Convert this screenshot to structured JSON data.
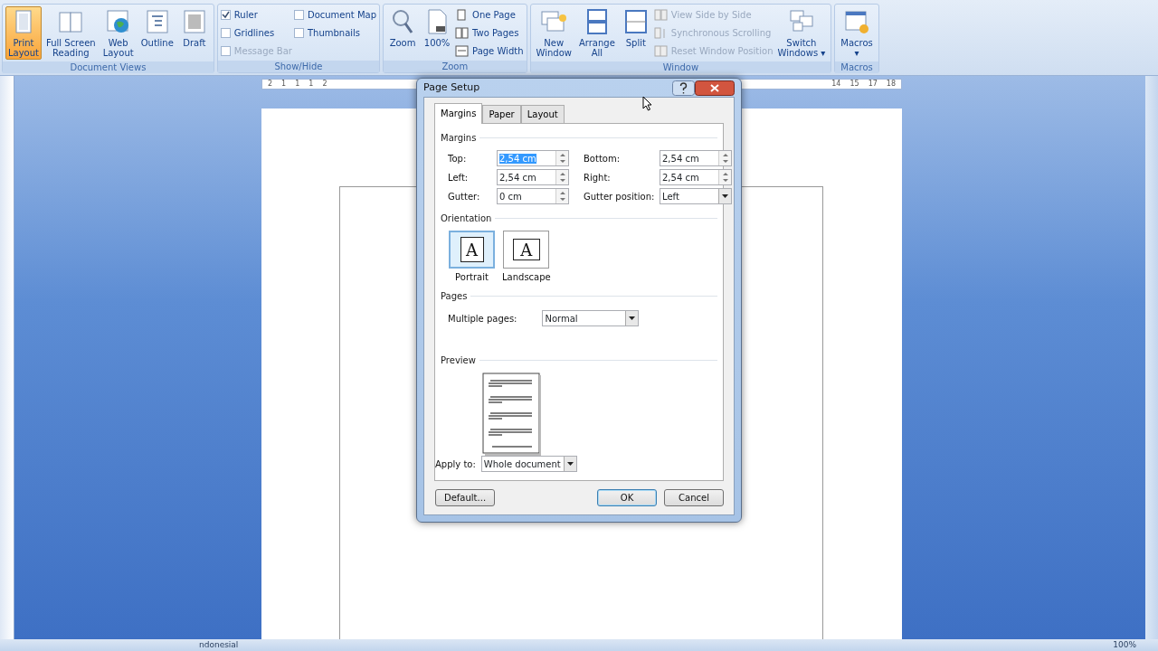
{
  "ribbon": {
    "groups": [
      {
        "label": "Document Views",
        "items": [
          {
            "kind": "big",
            "label": "Print\nLayout",
            "selected": true,
            "disabled": false
          },
          {
            "kind": "big",
            "label": "Full Screen\nReading",
            "selected": false,
            "disabled": false
          },
          {
            "kind": "big",
            "label": "Web\nLayout",
            "selected": false,
            "disabled": false
          },
          {
            "kind": "big",
            "label": "Outline",
            "selected": false,
            "disabled": false
          },
          {
            "kind": "big",
            "label": "Draft",
            "selected": false,
            "disabled": false
          }
        ]
      },
      {
        "label": "Show/Hide",
        "items": [
          {
            "kind": "check",
            "label": "Ruler",
            "checked": true,
            "disabled": false
          },
          {
            "kind": "check",
            "label": "Gridlines",
            "checked": false,
            "disabled": false
          },
          {
            "kind": "check",
            "label": "Message Bar",
            "checked": false,
            "disabled": true
          },
          {
            "kind": "check",
            "label": "Document Map",
            "checked": false,
            "disabled": false
          },
          {
            "kind": "check",
            "label": "Thumbnails",
            "checked": false,
            "disabled": false
          }
        ]
      },
      {
        "label": "Zoom",
        "items": [
          {
            "kind": "big",
            "label": "Zoom",
            "selected": false,
            "disabled": false
          },
          {
            "kind": "big",
            "label": "100%",
            "selected": false,
            "disabled": false
          },
          {
            "kind": "small",
            "label": "One Page",
            "disabled": false
          },
          {
            "kind": "small",
            "label": "Two Pages",
            "disabled": false
          },
          {
            "kind": "small",
            "label": "Page Width",
            "disabled": false
          }
        ]
      },
      {
        "label": "Window",
        "items": [
          {
            "kind": "big",
            "label": "New\nWindow",
            "selected": false,
            "disabled": false
          },
          {
            "kind": "big",
            "label": "Arrange\nAll",
            "selected": false,
            "disabled": false
          },
          {
            "kind": "big",
            "label": "Split",
            "selected": false,
            "disabled": false
          },
          {
            "kind": "small",
            "label": "View Side by Side",
            "disabled": true
          },
          {
            "kind": "small",
            "label": "Synchronous Scrolling",
            "disabled": true
          },
          {
            "kind": "small",
            "label": "Reset Window Position",
            "disabled": true
          },
          {
            "kind": "big",
            "label": "Switch\nWindows ▾",
            "selected": false,
            "disabled": false
          }
        ]
      },
      {
        "label": "Macros",
        "items": [
          {
            "kind": "big",
            "label": "Macros\n▾",
            "selected": false,
            "disabled": false
          }
        ]
      }
    ]
  },
  "ruler": {
    "left_numbers": [
      "2",
      "1",
      "1",
      "1",
      "2"
    ],
    "right_numbers": [
      "14",
      "15",
      "17",
      "18"
    ]
  },
  "dialog": {
    "title": "Page Setup",
    "tabs": [
      {
        "label": "Margins",
        "selected": true
      },
      {
        "label": "Paper",
        "selected": false
      },
      {
        "label": "Layout",
        "selected": false
      }
    ],
    "margins_heading": "Margins",
    "fields": [
      {
        "label": "Top:",
        "value": "2,54 cm",
        "kind": "spin",
        "text_selected": true
      },
      {
        "label": "Bottom:",
        "value": "2,54 cm",
        "kind": "spin",
        "text_selected": false
      },
      {
        "label": "Left:",
        "value": "2,54 cm",
        "kind": "spin",
        "text_selected": false
      },
      {
        "label": "Right:",
        "value": "2,54 cm",
        "kind": "spin",
        "text_selected": false
      },
      {
        "label": "Gutter:",
        "value": "0 cm",
        "kind": "spin",
        "text_selected": false
      },
      {
        "label": "Gutter position:",
        "value": "Left",
        "kind": "select",
        "text_selected": false
      }
    ],
    "orientation_heading": "Orientation",
    "orientations": [
      {
        "label": "Portrait",
        "glyph": "A",
        "selected": true
      },
      {
        "label": "Landscape",
        "glyph": "A",
        "selected": false
      }
    ],
    "pages_heading": "Pages",
    "multiple_pages": {
      "label": "Multiple pages:",
      "value": "Normal"
    },
    "preview_heading": "Preview",
    "apply_to": {
      "label": "Apply to:",
      "value": "Whole document"
    },
    "buttons": [
      {
        "label": "Default...",
        "default": false
      },
      {
        "label": "OK",
        "default": true
      },
      {
        "label": "Cancel",
        "default": false
      }
    ]
  },
  "status_bar": {
    "language": "ndonesial",
    "zoom": "100%"
  }
}
